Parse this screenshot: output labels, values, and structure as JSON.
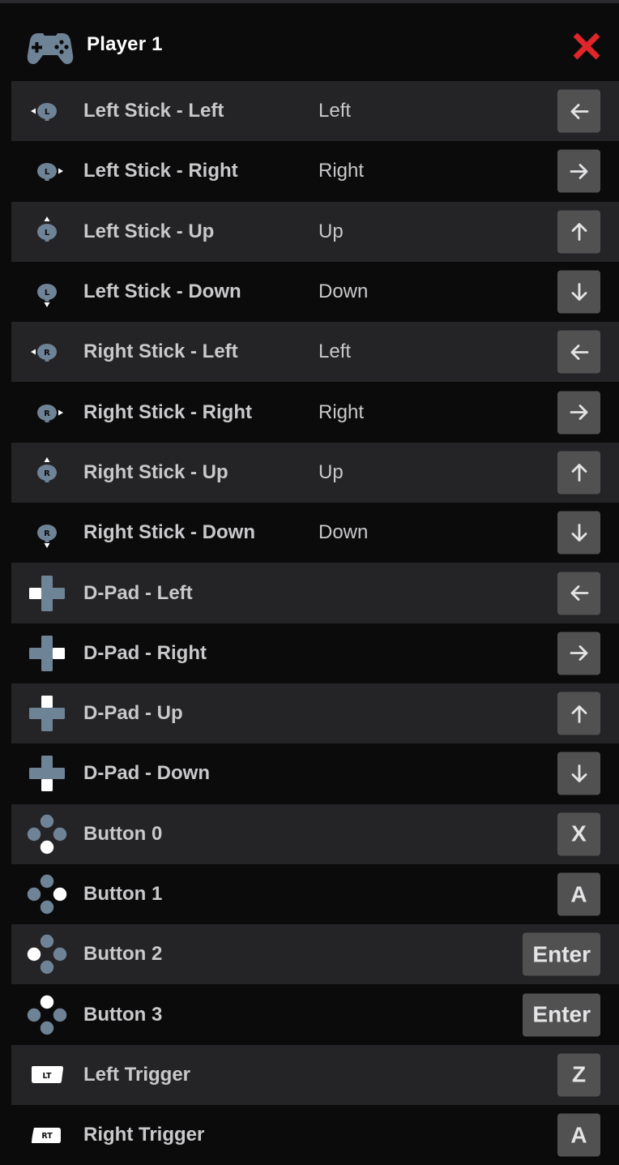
{
  "header": {
    "title": "Player 1",
    "icon": "gamepad-icon",
    "close_label": "X",
    "close_color": "#e0262a"
  },
  "colors": {
    "background": "#0c0b0c",
    "row_shaded": "#242325",
    "icon_slate": "#6f8397",
    "key_bg": "#525152",
    "text": "#c9c9cb"
  },
  "bindings": [
    {
      "control": "Left Stick - Left",
      "mapped": "Left",
      "key": "←",
      "key_icon": "arrow-left-icon",
      "control_icon": "left-stick-left-icon"
    },
    {
      "control": "Left Stick - Right",
      "mapped": "Right",
      "key": "→",
      "key_icon": "arrow-right-icon",
      "control_icon": "left-stick-right-icon"
    },
    {
      "control": "Left Stick - Up",
      "mapped": "Up",
      "key": "↑",
      "key_icon": "arrow-up-icon",
      "control_icon": "left-stick-up-icon"
    },
    {
      "control": "Left Stick - Down",
      "mapped": "Down",
      "key": "↓",
      "key_icon": "arrow-down-icon",
      "control_icon": "left-stick-down-icon"
    },
    {
      "control": "Right Stick - Left",
      "mapped": "Left",
      "key": "←",
      "key_icon": "arrow-left-icon",
      "control_icon": "right-stick-left-icon"
    },
    {
      "control": "Right Stick - Right",
      "mapped": "Right",
      "key": "→",
      "key_icon": "arrow-right-icon",
      "control_icon": "right-stick-right-icon"
    },
    {
      "control": "Right Stick - Up",
      "mapped": "Up",
      "key": "↑",
      "key_icon": "arrow-up-icon",
      "control_icon": "right-stick-up-icon"
    },
    {
      "control": "Right Stick - Down",
      "mapped": "Down",
      "key": "↓",
      "key_icon": "arrow-down-icon",
      "control_icon": "right-stick-down-icon"
    },
    {
      "control": "D-Pad - Left",
      "mapped": "",
      "key": "←",
      "key_icon": "arrow-left-icon",
      "control_icon": "dpad-left-icon"
    },
    {
      "control": "D-Pad - Right",
      "mapped": "",
      "key": "→",
      "key_icon": "arrow-right-icon",
      "control_icon": "dpad-right-icon"
    },
    {
      "control": "D-Pad - Up",
      "mapped": "",
      "key": "↑",
      "key_icon": "arrow-up-icon",
      "control_icon": "dpad-up-icon"
    },
    {
      "control": "D-Pad - Down",
      "mapped": "",
      "key": "↓",
      "key_icon": "arrow-down-icon",
      "control_icon": "dpad-down-icon"
    },
    {
      "control": "Button 0",
      "mapped": "",
      "key": "X",
      "key_icon": "",
      "control_icon": "face-button-bottom-icon"
    },
    {
      "control": "Button 1",
      "mapped": "",
      "key": "A",
      "key_icon": "",
      "control_icon": "face-button-right-icon"
    },
    {
      "control": "Button 2",
      "mapped": "",
      "key": "Enter",
      "key_icon": "",
      "control_icon": "face-button-left-icon"
    },
    {
      "control": "Button 3",
      "mapped": "",
      "key": "Enter",
      "key_icon": "",
      "control_icon": "face-button-top-icon"
    },
    {
      "control": "Left Trigger",
      "mapped": "",
      "key": "Z",
      "key_icon": "",
      "control_icon": "left-trigger-icon",
      "control_icon_text": "LT"
    },
    {
      "control": "Right Trigger",
      "mapped": "",
      "key": "A",
      "key_icon": "",
      "control_icon": "right-trigger-icon",
      "control_icon_text": "RT"
    }
  ]
}
